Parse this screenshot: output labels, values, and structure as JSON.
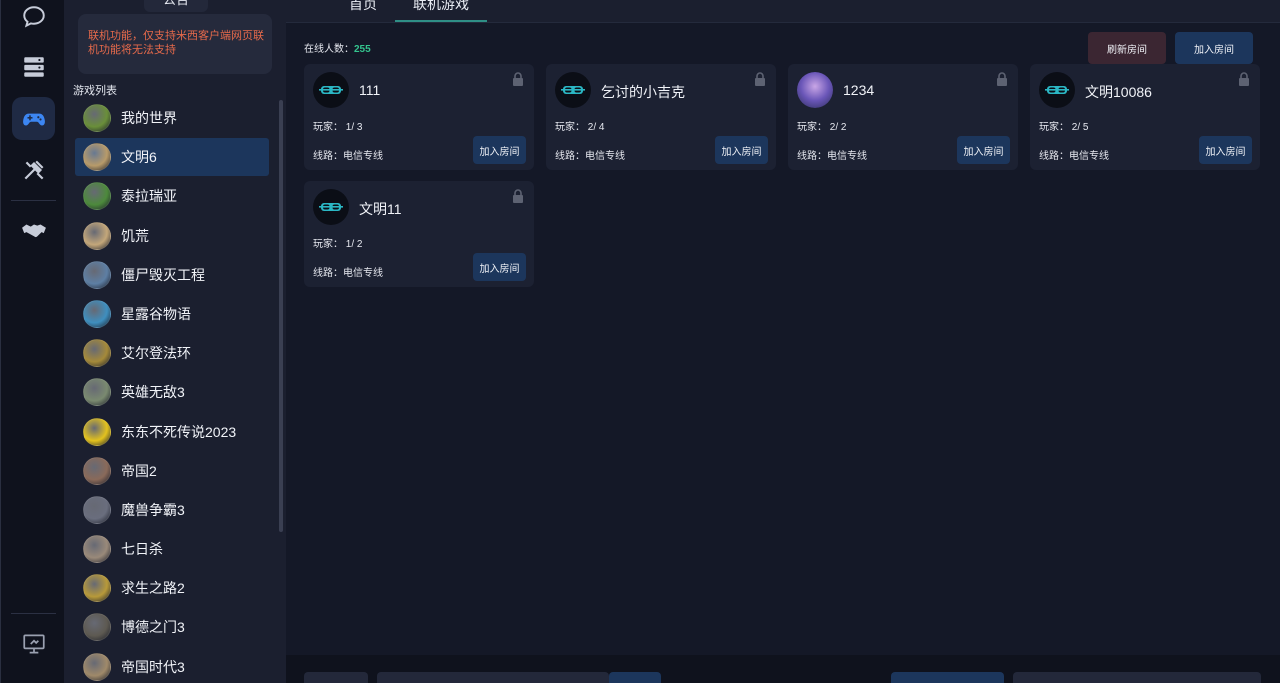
{
  "rail": {
    "items": [
      {
        "name": "chat",
        "icon": "chat-bubble-icon"
      },
      {
        "name": "servers",
        "icon": "server-icon"
      },
      {
        "name": "games",
        "icon": "gamepad-icon",
        "active": true
      },
      {
        "name": "tools",
        "icon": "tools-icon"
      },
      {
        "name": "partners",
        "icon": "handshake-icon"
      },
      {
        "name": "desktop",
        "icon": "monitor-icon"
      }
    ]
  },
  "sidebar": {
    "notice_tab": "公告",
    "notice_text": "联机功能，仅支持米西客户端网页联机功能将无法支持",
    "list_title": "游戏列表",
    "games": [
      {
        "name": "我的世界",
        "color": "#6a8f3a"
      },
      {
        "name": "文明6",
        "color": "#b89b6a",
        "active": true
      },
      {
        "name": "泰拉瑞亚",
        "color": "#4d8a3c"
      },
      {
        "name": "饥荒",
        "color": "#c4a77a"
      },
      {
        "name": "僵尸毁灭工程",
        "color": "#5e7fa4"
      },
      {
        "name": "星露谷物语",
        "color": "#3f8fbf"
      },
      {
        "name": "艾尔登法环",
        "color": "#a58a3a"
      },
      {
        "name": "英雄无敌3",
        "color": "#7a8a70"
      },
      {
        "name": "东东不死传说2023",
        "color": "#e3c21e"
      },
      {
        "name": "帝国2",
        "color": "#8a6a5a"
      },
      {
        "name": "魔兽争霸3",
        "color": "#6a6e7e"
      },
      {
        "name": "七日杀",
        "color": "#9a8a7a"
      },
      {
        "name": "求生之路2",
        "color": "#b89a3a"
      },
      {
        "name": "博德之门3",
        "color": "#5e5a52"
      },
      {
        "name": "帝国时代3",
        "color": "#a08a6a"
      }
    ]
  },
  "tabs": [
    {
      "label": "首页"
    },
    {
      "label": "联机游戏",
      "active": true
    }
  ],
  "main": {
    "online_label": "在线人数：",
    "online_count": "255",
    "refresh_label": "刷新房间",
    "join_label": "加入房间"
  },
  "rooms": [
    {
      "name": "111",
      "players": "玩家： 1/ 3",
      "line": "线路：电信专线",
      "join": "加入房间",
      "avatar": "goggles"
    },
    {
      "name": "乞讨的小吉克",
      "players": "玩家： 2/ 4",
      "line": "线路：电信专线",
      "join": "加入房间",
      "avatar": "goggles"
    },
    {
      "name": "1234",
      "players": "玩家： 2/ 2",
      "line": "线路：电信专线",
      "join": "加入房间",
      "avatar": "photo"
    },
    {
      "name": "文明10086",
      "players": "玩家： 2/ 5",
      "line": "线路：电信专线",
      "join": "加入房间",
      "avatar": "goggles"
    },
    {
      "name": "文明11",
      "players": "玩家： 1/ 2",
      "line": "线路：电信专线",
      "join": "加入房间",
      "avatar": "goggles"
    }
  ],
  "colors": {
    "accent": "#34c48e",
    "button_blue": "#1c365c",
    "button_refresh": "#3b2632",
    "notice_text": "#e66a4b"
  }
}
